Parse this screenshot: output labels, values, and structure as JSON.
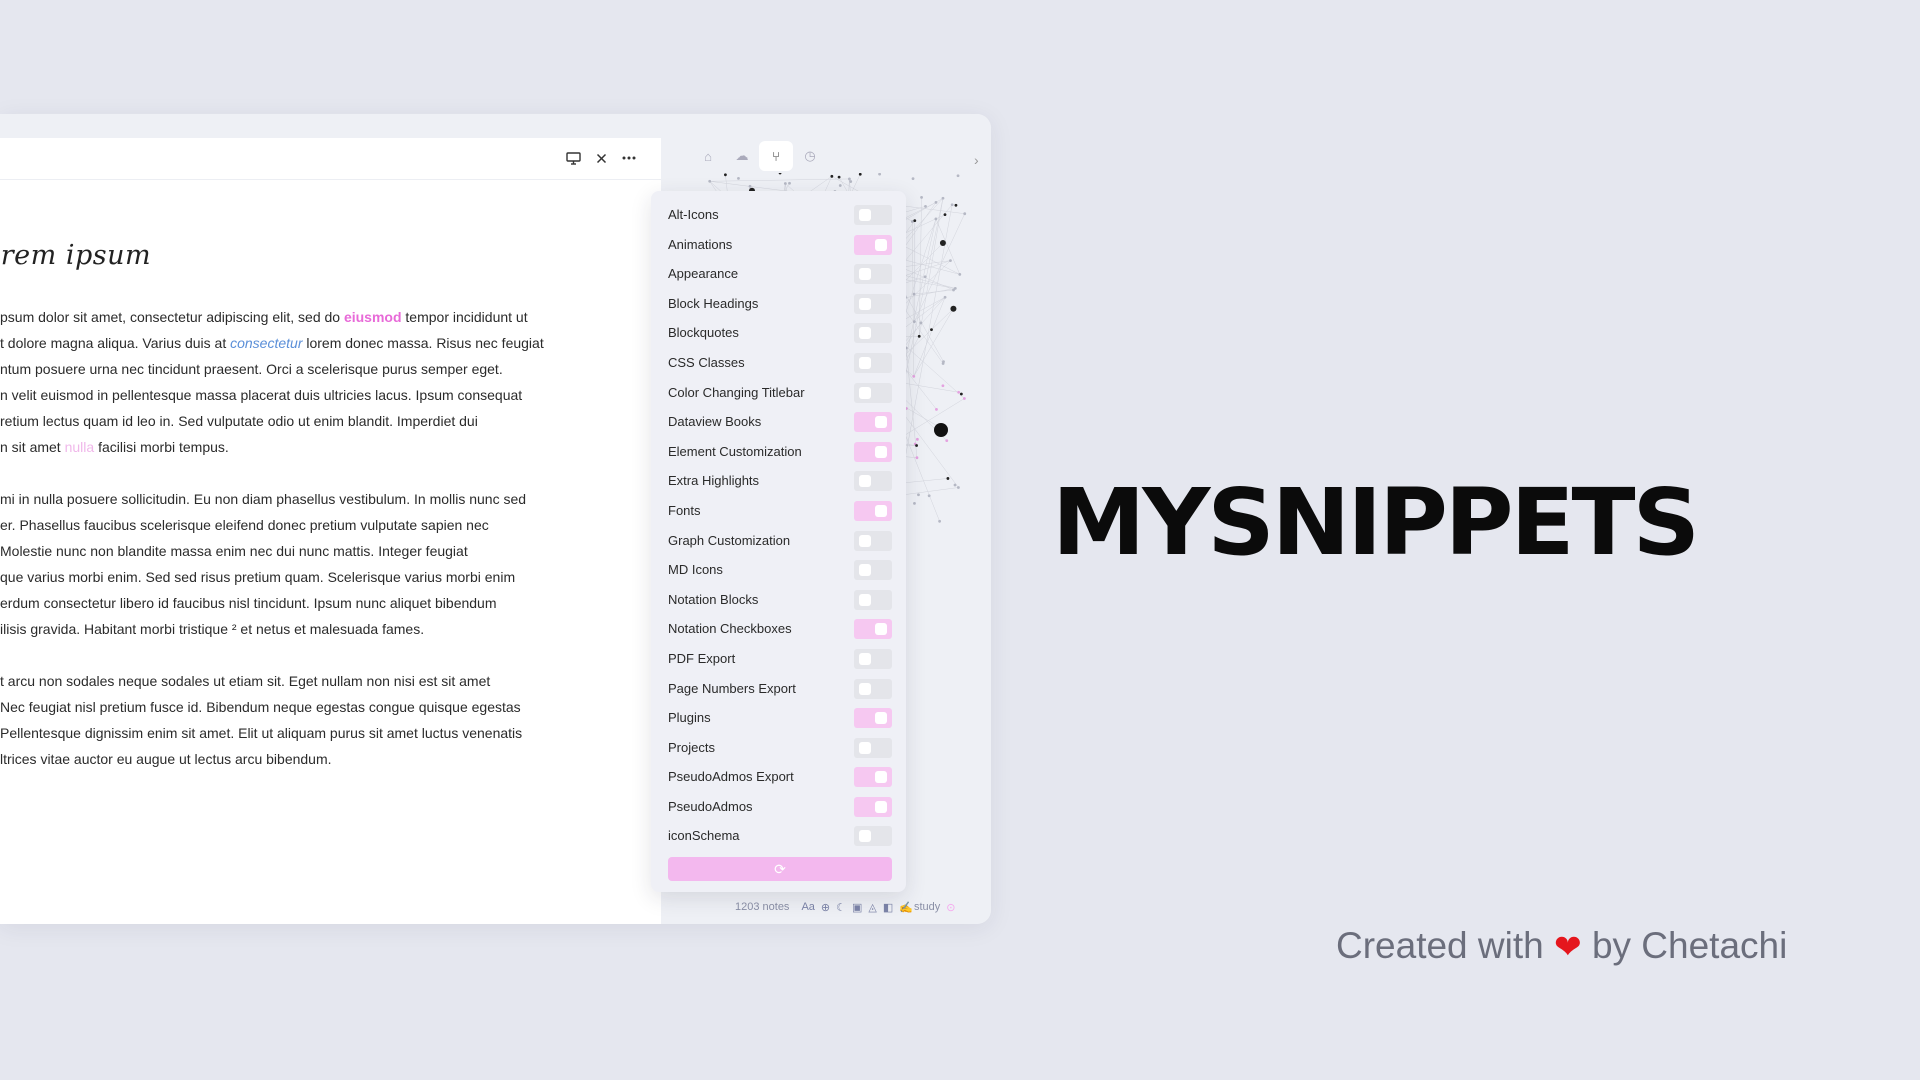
{
  "editor": {
    "header_icons": [
      "monitor-icon",
      "close-icon",
      "more-icon"
    ],
    "title": "orem ipsum",
    "paragraphs": [
      [
        [
          {
            "t": "psum dolor sit amet, consectetur adipiscing elit, sed do "
          },
          {
            "t": "eiusmod",
            "s": "pink"
          },
          {
            "t": " tempor incididunt ut"
          }
        ],
        [
          {
            "t": "t dolore magna aliqua. Varius duis at "
          },
          {
            "t": "consectetur",
            "s": "blue"
          },
          {
            "t": " lorem donec massa. Risus nec feugiat"
          }
        ],
        [
          {
            "t": "ntum posuere urna nec tincidunt praesent. Orci a scelerisque purus semper eget."
          }
        ],
        [
          {
            "t": "n velit euismod in pellentesque massa placerat duis ultricies lacus. Ipsum consequat"
          }
        ],
        [
          {
            "t": "retium lectus quam id leo in. Sed vulputate odio ut enim blandit. Imperdiet dui"
          }
        ],
        [
          {
            "t": "n sit amet "
          },
          {
            "t": "nulla",
            "s": "light"
          },
          {
            "t": " facilisi morbi tempus."
          }
        ]
      ],
      [
        [
          {
            "t": "mi in nulla posuere sollicitudin. Eu non diam phasellus vestibulum. In mollis nunc sed"
          }
        ],
        [
          {
            "t": "er. Phasellus faucibus scelerisque eleifend donec pretium vulputate sapien nec"
          }
        ],
        [
          {
            "t": "Molestie nunc non blandite massa enim nec dui nunc mattis. Integer feugiat"
          }
        ],
        [
          {
            "t": "que varius morbi enim. Sed sed risus pretium quam. Scelerisque varius morbi enim"
          }
        ],
        [
          {
            "t": "erdum consectetur libero id faucibus nisl tincidunt. Ipsum nunc aliquet bibendum"
          }
        ],
        [
          {
            "t": "ilisis gravida. Habitant morbi tristique ² et netus et malesuada fames."
          }
        ]
      ],
      [
        [
          {
            "t": "t arcu non sodales neque sodales ut etiam sit. Eget nullam non nisi est sit amet"
          }
        ],
        [
          {
            "t": "Nec feugiat nisl pretium fusce id. Bibendum neque egestas congue quisque egestas"
          }
        ],
        [
          {
            "t": "Pellentesque dignissim enim sit amet. Elit ut aliquam purus sit amet luctus venenatis"
          }
        ],
        [
          {
            "t": "ltrices vitae auctor eu augue ut lectus arcu bibendum."
          }
        ]
      ]
    ]
  },
  "sidebar": {
    "tabs": [
      {
        "icon": "robot-icon",
        "glyph": "⌂",
        "active": false
      },
      {
        "icon": "cloud-icon",
        "glyph": "☁",
        "active": false
      },
      {
        "icon": "graph-icon",
        "glyph": "⑂",
        "active": true
      },
      {
        "icon": "clock-icon",
        "glyph": "◷",
        "active": false
      }
    ],
    "chevron": "›"
  },
  "snippets": {
    "items": [
      {
        "label": "Alt-Icons",
        "on": false
      },
      {
        "label": "Animations",
        "on": true
      },
      {
        "label": "Appearance",
        "on": false
      },
      {
        "label": "Block Headings",
        "on": false
      },
      {
        "label": "Blockquotes",
        "on": false
      },
      {
        "label": "CSS Classes",
        "on": false
      },
      {
        "label": "Color Changing Titlebar",
        "on": false
      },
      {
        "label": "Dataview Books",
        "on": true
      },
      {
        "label": "Element Customization",
        "on": true
      },
      {
        "label": "Extra Highlights",
        "on": false
      },
      {
        "label": "Fonts",
        "on": true
      },
      {
        "label": "Graph Customization",
        "on": false
      },
      {
        "label": "MD Icons",
        "on": false
      },
      {
        "label": "Notation Blocks",
        "on": false
      },
      {
        "label": "Notation Checkboxes",
        "on": true
      },
      {
        "label": "PDF Export",
        "on": false
      },
      {
        "label": "Page Numbers Export",
        "on": false
      },
      {
        "label": "Plugins",
        "on": true
      },
      {
        "label": "Projects",
        "on": false
      },
      {
        "label": "PseudoAdmos Export",
        "on": true
      },
      {
        "label": "PseudoAdmos",
        "on": true
      },
      {
        "label": "iconSchema",
        "on": false
      }
    ],
    "reload_icon": "refresh-icon",
    "reload_glyph": "⟳"
  },
  "status_bar": {
    "notes": "1203 notes",
    "font_label": "Aa",
    "vault": "study",
    "vault_emoji": "✍"
  },
  "brand": {
    "title": "MYSNIPPETS",
    "credit_prefix": "Created with",
    "heart": "❤",
    "credit_suffix": "by Chetachi"
  },
  "colors": {
    "accent_pink": "#f3b8ee",
    "toggle_on": "#f6c8f1",
    "link_blue": "#5b8fd8",
    "heart_red": "#e5161d"
  }
}
